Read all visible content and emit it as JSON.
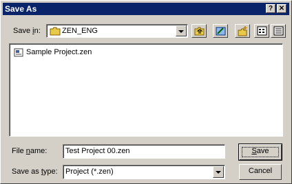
{
  "window": {
    "title": "Save As",
    "help_glyph": "?",
    "close_glyph": "✕"
  },
  "save_in": {
    "label_pre": "Save ",
    "label_key": "i",
    "label_post": "n:",
    "value": "ZEN_ENG"
  },
  "toolbar": {
    "icons": [
      "up-one-level-icon",
      "desktop-icon",
      "new-folder-icon",
      "list-view-icon",
      "details-view-icon"
    ]
  },
  "files": [
    {
      "name": "Sample Project.zen",
      "icon": "zen-file-icon"
    }
  ],
  "file_name": {
    "label_pre": "File ",
    "label_key": "n",
    "label_post": "ame:",
    "value": "Test Project 00.zen"
  },
  "save_type": {
    "label_pre": "Save as ",
    "label_key": "t",
    "label_post": "ype:",
    "value": "Project (*.zen)"
  },
  "buttons": {
    "save_key": "S",
    "save_rest": "ave",
    "cancel": "Cancel"
  },
  "colors": {
    "titlebar": "#0a246a",
    "face": "#d4d0c8",
    "folder": "#e8c94a"
  }
}
